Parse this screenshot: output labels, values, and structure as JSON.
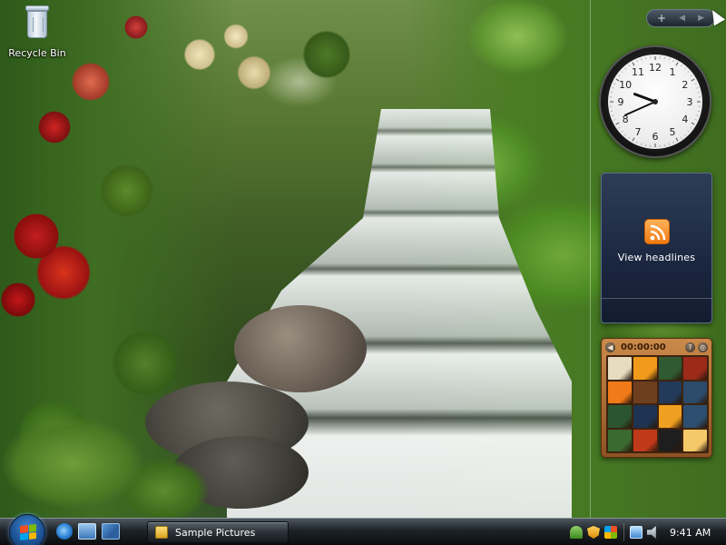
{
  "desktop": {
    "recycle_bin_label": "Recycle Bin"
  },
  "sidebar": {
    "controls": {
      "add_symbol": "+",
      "prev_symbol": "◀",
      "next_symbol": "▶"
    },
    "clock": {
      "numbers": [
        "12",
        "1",
        "2",
        "3",
        "4",
        "5",
        "6",
        "7",
        "8",
        "9",
        "10",
        "11"
      ],
      "time_hours": 9,
      "time_minutes": 41
    },
    "feed": {
      "label": "View headlines",
      "accent_color": "#f07b12"
    },
    "puzzle": {
      "timer": "00:00:00",
      "left_symbol": "◀",
      "help_symbol": "?",
      "right_symbol": "◎",
      "tiles": [
        "#e8dcc0",
        "#f29a1c",
        "#2f5a32",
        "#9c2a1a",
        "#f07a18",
        "empty",
        "#233a5a",
        "#2c4a6a",
        "#2b5530",
        "#1f3352",
        "#f0a020",
        "#2d4f6f",
        "#3a6a30",
        "#c03a1a",
        "#1e1e1e",
        "#f5c86a"
      ]
    }
  },
  "taskbar": {
    "task_button_label": "Sample Pictures",
    "time": "9:41 AM",
    "colors": {
      "accent": "#3f86d1"
    }
  }
}
